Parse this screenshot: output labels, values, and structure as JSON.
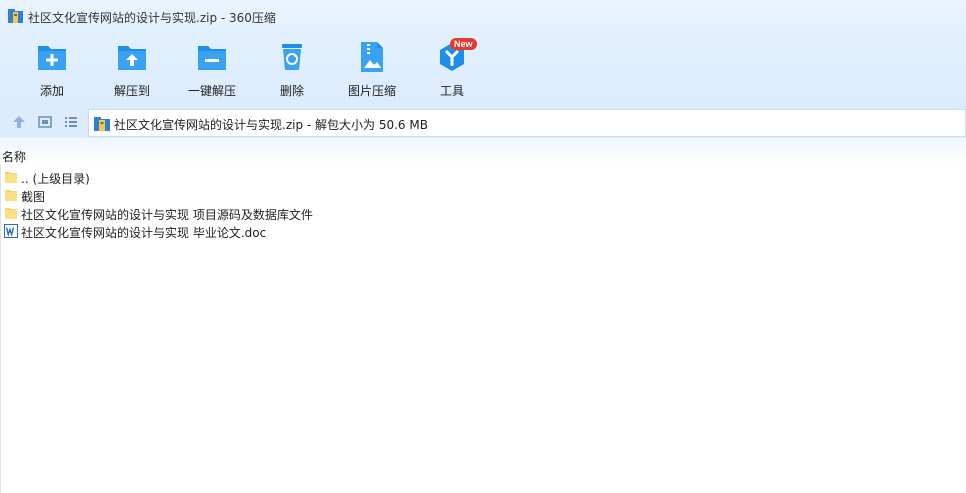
{
  "window": {
    "title": "社区文化宣传网站的设计与实现.zip - 360压缩"
  },
  "toolbar": {
    "buttons": [
      {
        "label": "添加",
        "icon": "add-folder-icon"
      },
      {
        "label": "解压到",
        "icon": "extract-to-folder-icon"
      },
      {
        "label": "一键解压",
        "icon": "one-click-extract-icon"
      },
      {
        "label": "删除",
        "icon": "recycle-bin-icon"
      },
      {
        "label": "图片压缩",
        "icon": "image-compress-icon"
      },
      {
        "label": "工具",
        "icon": "tools-icon",
        "badge": "New"
      }
    ]
  },
  "nav": {
    "address": "社区文化宣传网站的设计与实现.zip - 解包大小为 50.6 MB"
  },
  "list": {
    "column_name": "名称",
    "items": [
      {
        "name": ".. (上级目录)",
        "type": "folder"
      },
      {
        "name": "截图",
        "type": "folder"
      },
      {
        "name": "社区文化宣传网站的设计与实现 项目源码及数据库文件",
        "type": "folder"
      },
      {
        "name": "社区文化宣传网站的设计与实现 毕业论文.doc",
        "type": "word-doc"
      }
    ]
  },
  "colors": {
    "accent": "#1e8fe8",
    "toolbar_bg": "#e2f0fe",
    "folder": "#f7d36b",
    "badge": "#e63a2f"
  }
}
